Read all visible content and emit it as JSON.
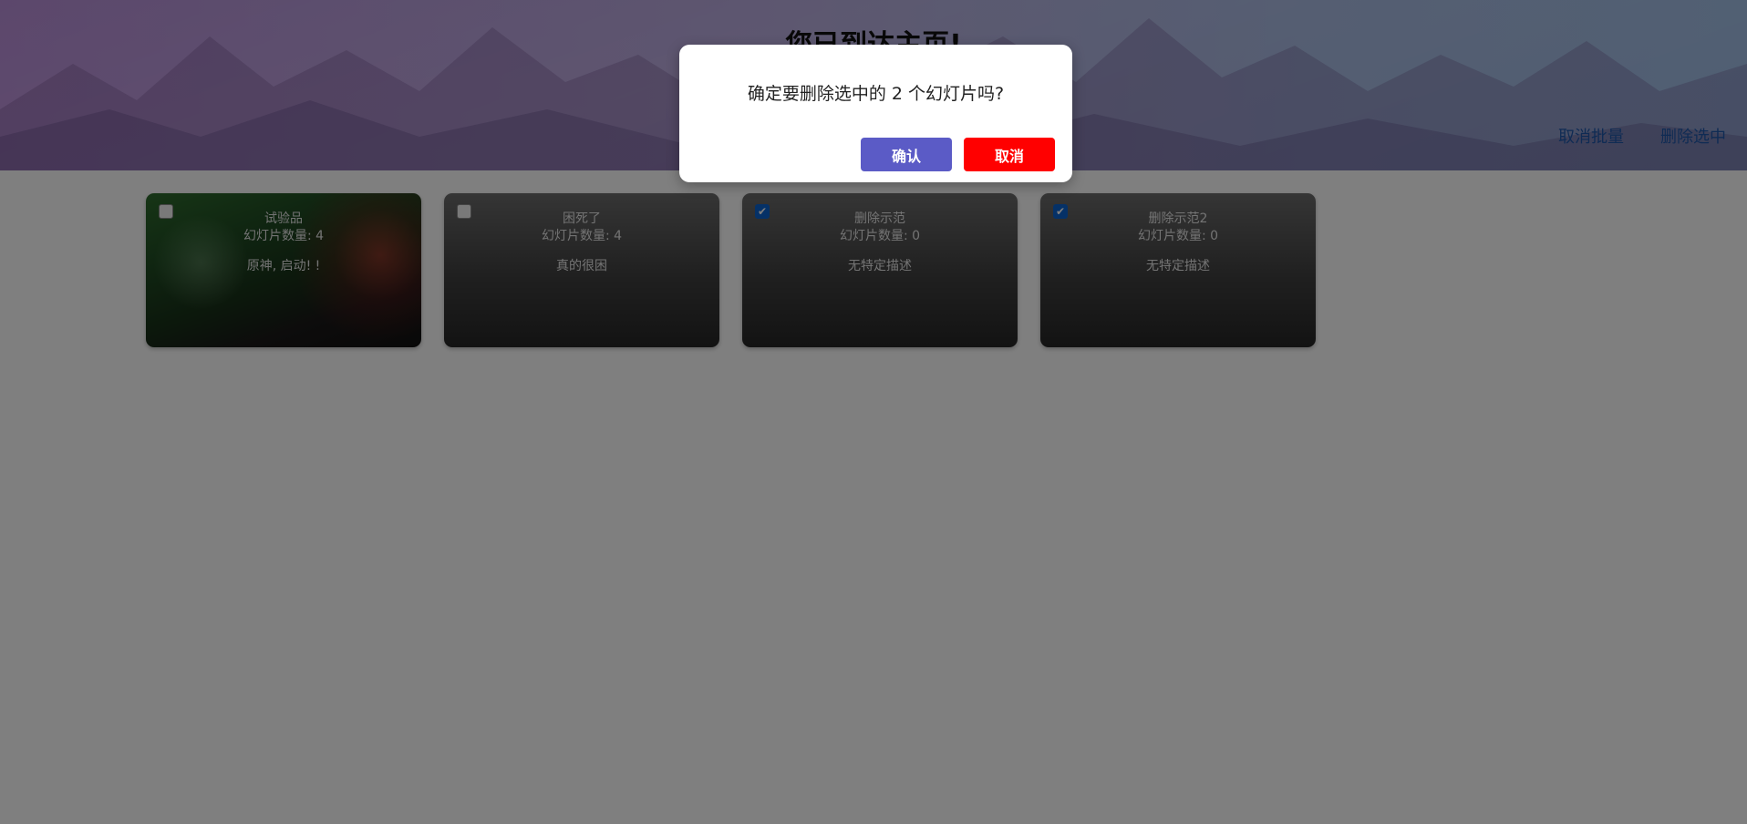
{
  "header": {
    "title": "您已到达主页!",
    "cancel_batch": "取消批量",
    "delete_selected": "删除选中"
  },
  "cards": [
    {
      "title": "试验品",
      "count": "幻灯片数量: 4",
      "desc": "原神, 启动! !",
      "checked": false
    },
    {
      "title": "困死了",
      "count": "幻灯片数量: 4",
      "desc": "真的很困",
      "checked": false
    },
    {
      "title": "删除示范",
      "count": "幻灯片数量: 0",
      "desc": "无特定描述",
      "checked": true
    },
    {
      "title": "删除示范2",
      "count": "幻灯片数量: 0",
      "desc": "无特定描述",
      "checked": true
    }
  ],
  "dialog": {
    "message": "确定要删除选中的 2 个幻灯片吗?",
    "confirm": "确认",
    "cancel": "取消"
  },
  "colors": {
    "confirm_button": "#5b5bc6",
    "cancel_button": "#ff0000",
    "link": "#1f57a8",
    "checkbox_checked": "#0b63ce"
  }
}
